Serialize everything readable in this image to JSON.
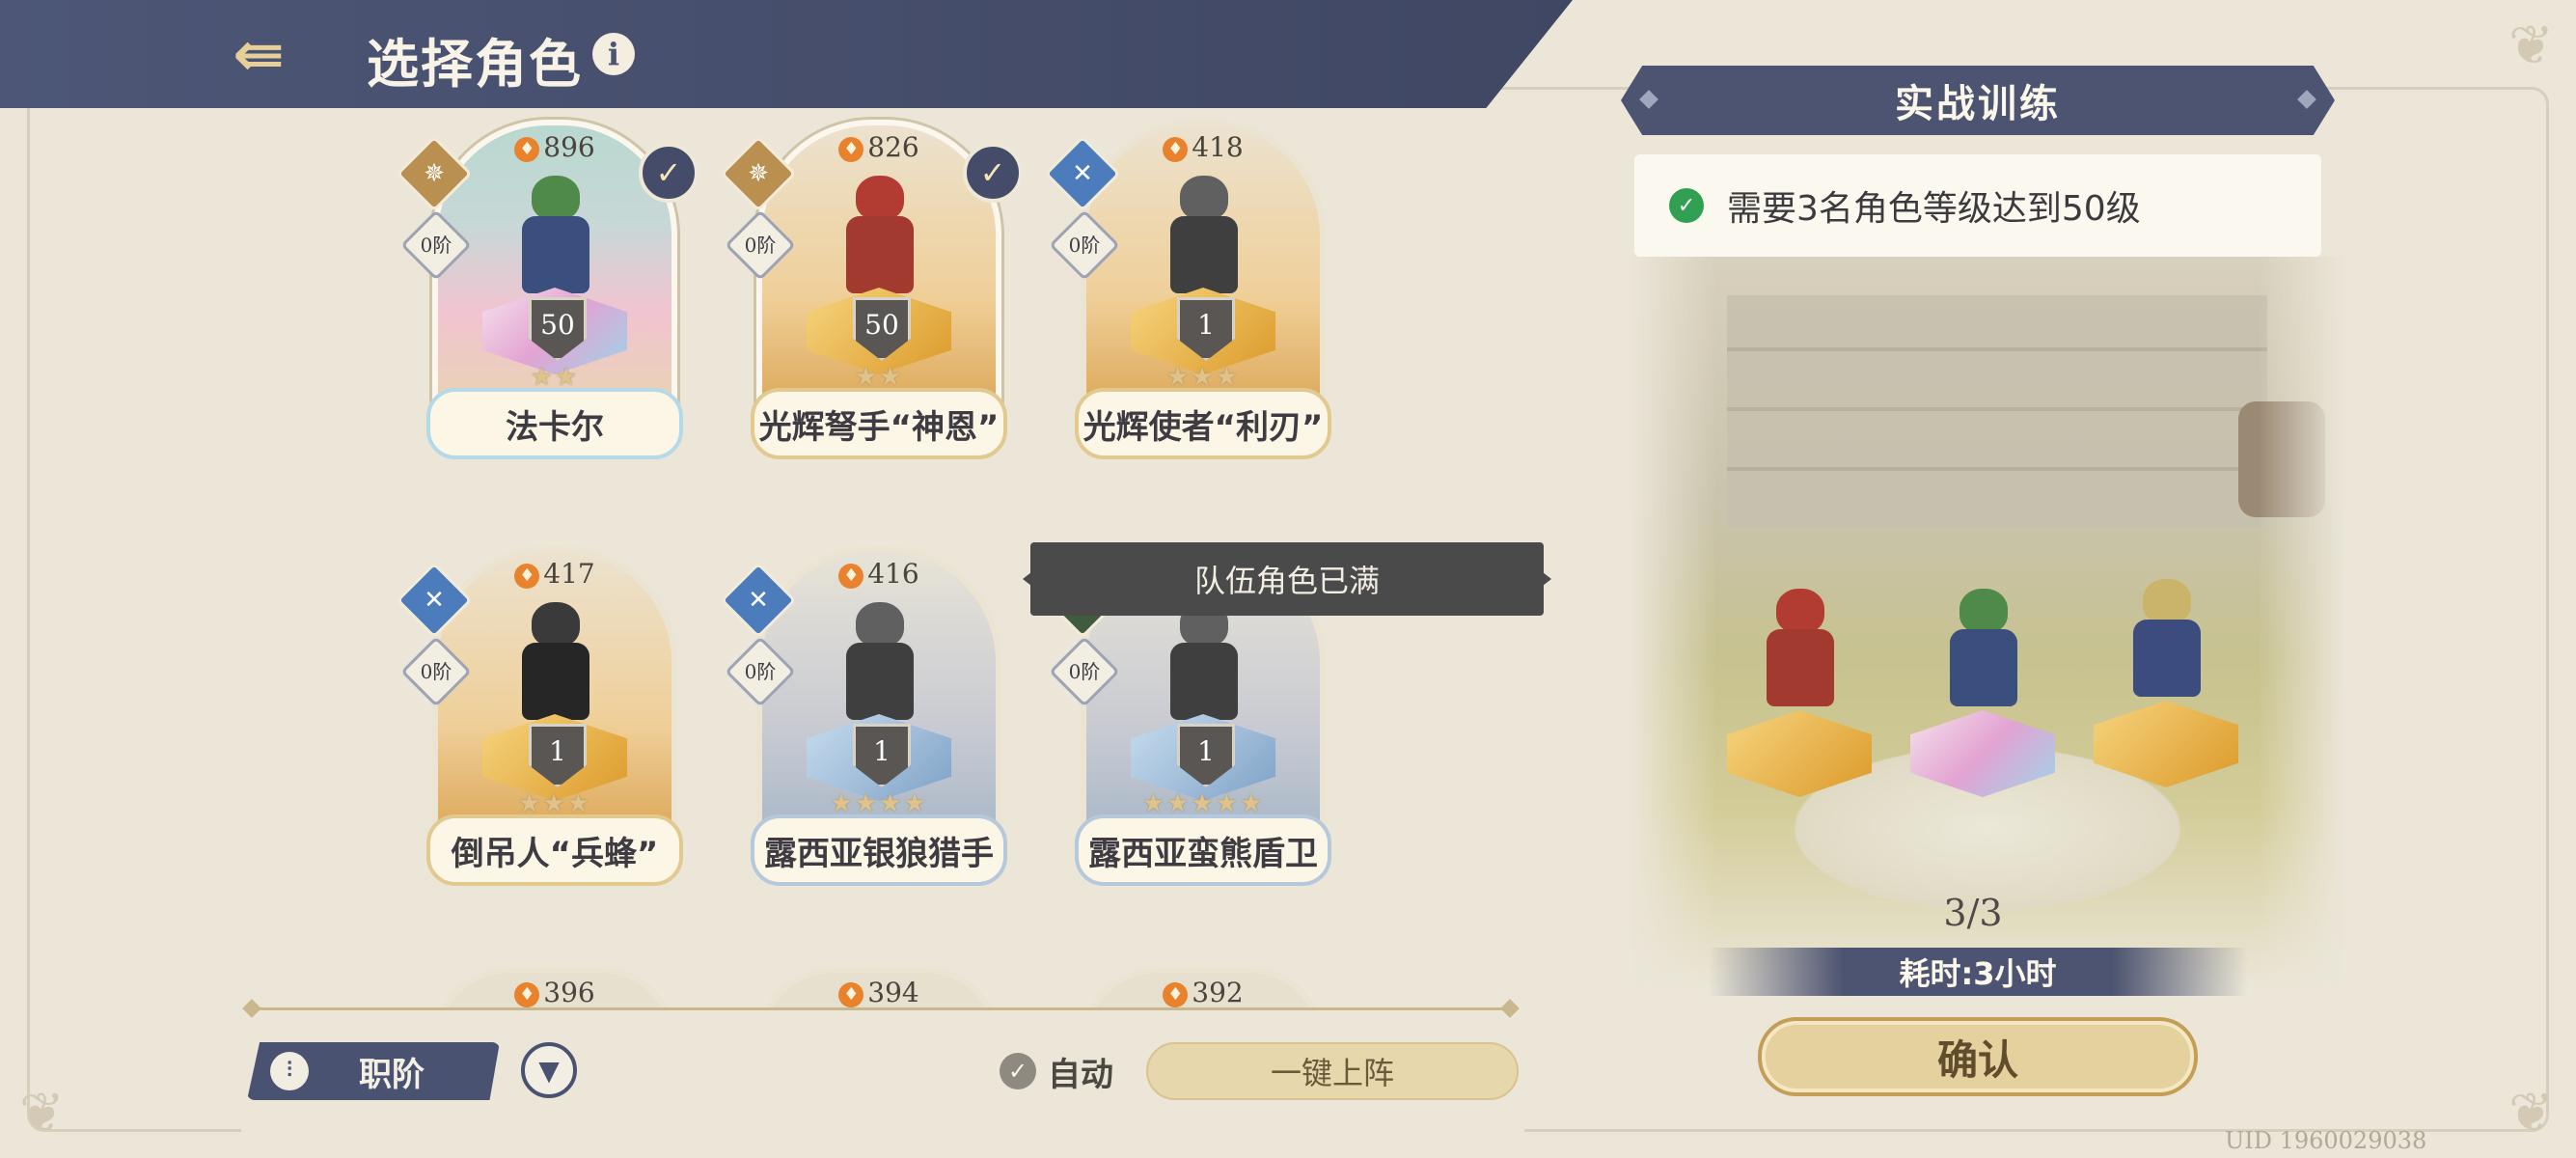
{
  "header": {
    "title": "选择角色",
    "back_icon": "back-arrow-icon",
    "info_icon": "info-icon"
  },
  "tooltip": "队伍角色已满",
  "characters": [
    {
      "name": "法卡尔",
      "power": "896",
      "rank": "0阶",
      "level": "50",
      "stars": "★★",
      "selected": true,
      "class_color": "#b99050",
      "theme": "rainbow"
    },
    {
      "name": "光辉弩手“神恩”",
      "power": "826",
      "rank": "0阶",
      "level": "50",
      "stars": "★★",
      "selected": true,
      "class_color": "#b99050",
      "theme": "gold"
    },
    {
      "name": "光辉使者“利刃”",
      "power": "418",
      "rank": "0阶",
      "level": "1",
      "stars": "★★★",
      "selected": false,
      "class_color": "#4d7cbd",
      "theme": "gold"
    },
    {
      "name": "倒吊人“兵蜂”",
      "power": "417",
      "rank": "0阶",
      "level": "1",
      "stars": "★★★",
      "selected": false,
      "class_color": "#4d7cbd",
      "theme": "gold"
    },
    {
      "name": "露西亚银狼猎手",
      "power": "416",
      "rank": "0阶",
      "level": "1",
      "stars": "★★★★",
      "selected": false,
      "class_color": "#4d7cbd",
      "theme": "silver"
    },
    {
      "name": "露西亚蛮熊盾卫",
      "power": "",
      "rank": "0阶",
      "level": "1",
      "stars": "★★★★★",
      "selected": false,
      "class_color": "#3f5d3e",
      "theme": "silver"
    }
  ],
  "partial_row": [
    {
      "power": "396",
      "class_color": "#4d7cbd"
    },
    {
      "power": "394",
      "class_color": "#4d7cbd"
    },
    {
      "power": "392",
      "class_color": "#b44748"
    }
  ],
  "controls": {
    "class_filter_label": "职阶",
    "auto_label": "自动",
    "auto_checked": true,
    "one_click_label": "一键上阵"
  },
  "panel": {
    "title": "实战训练",
    "requirement": "需要3名角色等级达到50级",
    "team_count": "3/3",
    "duration": "耗时:3小时",
    "confirm_label": "确认"
  },
  "uid": "UID 1960029038",
  "colors": {
    "header_bg": "#4d5676",
    "accent_gold": "#e5d19e",
    "ok_green": "#32a053"
  }
}
